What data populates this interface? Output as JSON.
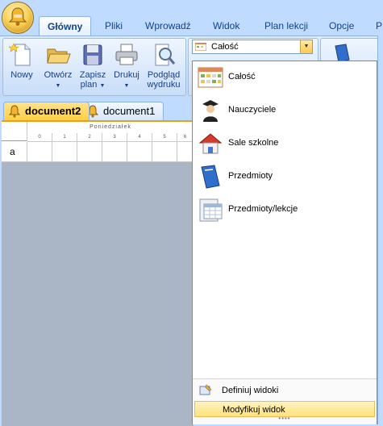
{
  "ribbon_tabs": [
    {
      "label": "Główny",
      "active": true
    },
    {
      "label": "Pliki"
    },
    {
      "label": "Wprowadź"
    },
    {
      "label": "Widok"
    },
    {
      "label": "Plan lekcji"
    },
    {
      "label": "Opcje"
    },
    {
      "label": "P"
    }
  ],
  "ribbon_buttons": {
    "new": "Nowy",
    "open": "Otwórz",
    "save_line1": "Zapisz",
    "save_line2": "plan",
    "print": "Drukuj",
    "preview_line1": "Podgląd",
    "preview_line2": "wydruku"
  },
  "view_combo": {
    "value": "Całość"
  },
  "documents": [
    {
      "label": "document2",
      "active": true
    },
    {
      "label": "document1"
    }
  ],
  "grid": {
    "day": "Poniedziałek",
    "periods": [
      "0",
      "1",
      "2",
      "3",
      "4",
      "5",
      "6"
    ],
    "row_label": "a"
  },
  "dropdown": {
    "items": [
      {
        "label": "Całość",
        "icon": "calendar-icon"
      },
      {
        "label": "Nauczyciele",
        "icon": "teacher-icon"
      },
      {
        "label": "Sale szkolne",
        "icon": "house-icon"
      },
      {
        "label": "Przedmioty",
        "icon": "book-icon"
      },
      {
        "label": "Przedmioty/lekcje",
        "icon": "document-grid-icon"
      }
    ],
    "define_views": "Definiuj widoki",
    "modify_view": "Modyfikuj widok"
  },
  "colors": {
    "ribbon_bg": "#bfdbff",
    "active_doc_tab": "#ffcf46",
    "highlight": "#ffe27a",
    "text_blue": "#15428b"
  }
}
